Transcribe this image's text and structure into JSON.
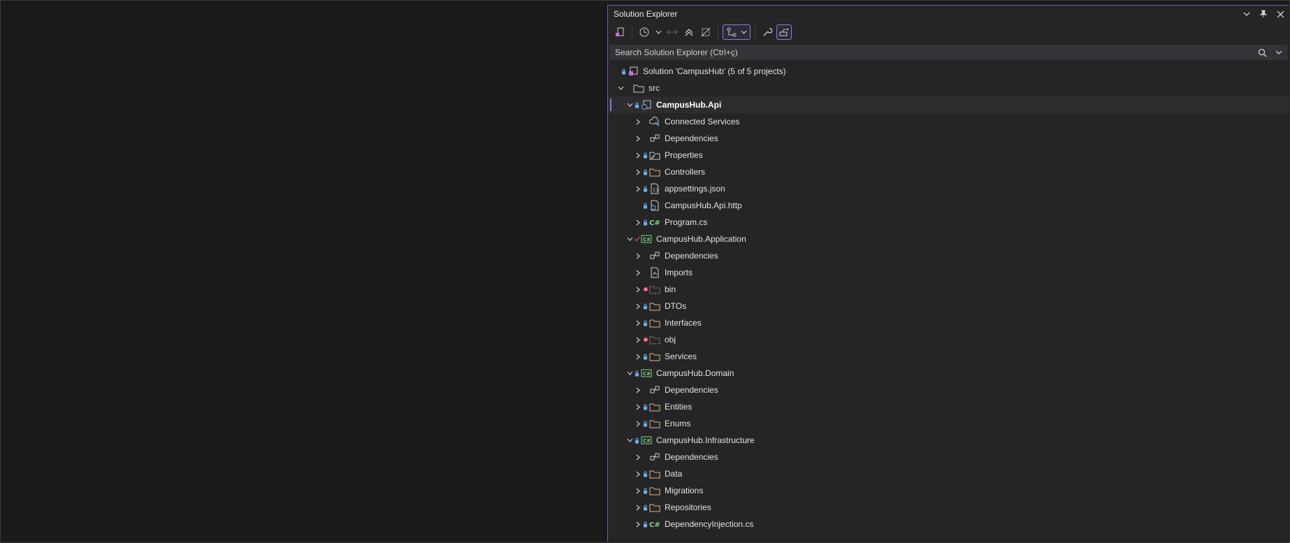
{
  "panel": {
    "title": "Solution Explorer",
    "search_placeholder": "Search Solution Explorer (Ctrl+ç)"
  },
  "tree": {
    "solution": "Solution 'CampusHub' (5 of 5 projects)",
    "src": "src",
    "api": {
      "name": "CampusHub.Api",
      "connected_services": "Connected Services",
      "dependencies": "Dependencies",
      "properties": "Properties",
      "controllers": "Controllers",
      "appsettings": "appsettings.json",
      "http": "CampusHub.Api.http",
      "program": "Program.cs"
    },
    "application": {
      "name": "CampusHub.Application",
      "dependencies": "Dependencies",
      "imports": "Imports",
      "bin": "bin",
      "dtos": "DTOs",
      "interfaces": "Interfaces",
      "obj": "obj",
      "services": "Services"
    },
    "domain": {
      "name": "CampusHub.Domain",
      "dependencies": "Dependencies",
      "entities": "Entities",
      "enums": "Enums"
    },
    "infrastructure": {
      "name": "CampusHub.Infrastructure",
      "dependencies": "Dependencies",
      "data": "Data",
      "migrations": "Migrations",
      "repositories": "Repositories",
      "dependency_injection": "DependencyInjection.cs"
    }
  }
}
